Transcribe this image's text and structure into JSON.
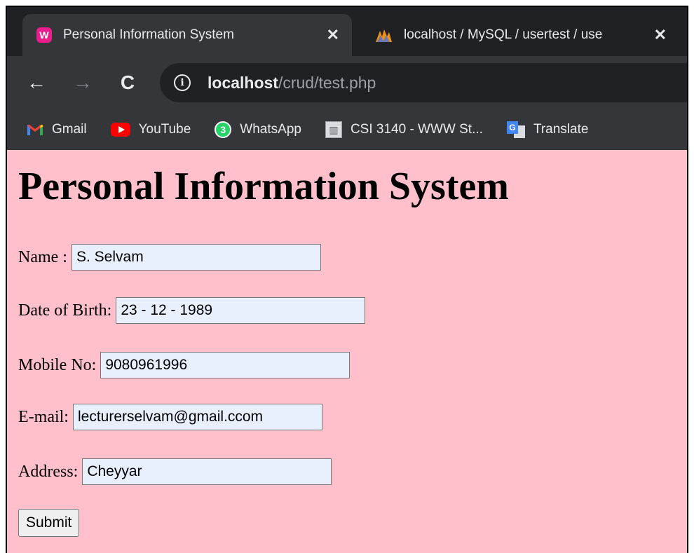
{
  "browser": {
    "tabs": [
      {
        "title": "Personal Information System",
        "close": "✕",
        "active": true
      },
      {
        "title": "localhost / MySQL / usertest / use",
        "close": "✕",
        "active": false
      }
    ],
    "nav": {
      "back": "←",
      "forward": "→",
      "reload": "C"
    },
    "address": {
      "info": "i",
      "host": "localhost",
      "path": "/crud/test.php"
    },
    "bookmarks": [
      {
        "label": "Gmail",
        "icon": "gmail-icon"
      },
      {
        "label": "YouTube",
        "icon": "youtube-icon"
      },
      {
        "label": "WhatsApp",
        "icon": "whatsapp-icon",
        "badge": "3"
      },
      {
        "label": "CSI 3140 - WWW St...",
        "icon": "building-icon"
      },
      {
        "label": "Translate",
        "icon": "google-translate-icon"
      }
    ]
  },
  "page": {
    "heading": "Personal Information System",
    "fields": {
      "name": {
        "label": "Name :",
        "value": "S. Selvam"
      },
      "dob": {
        "label": "Date of Birth:",
        "value": "23 - 12 - 1989"
      },
      "mobile": {
        "label": "Mobile No:",
        "value": "9080961996"
      },
      "email": {
        "label": "E-mail:",
        "value": "lecturerselvam@gmail.ccom"
      },
      "address": {
        "label": "Address:",
        "value": "Cheyyar"
      }
    },
    "submit_label": "Submit"
  },
  "colors": {
    "page_background": "#ffc0cb",
    "autofill_background": "#e8f0fe",
    "chrome_dark": "#35363a"
  }
}
